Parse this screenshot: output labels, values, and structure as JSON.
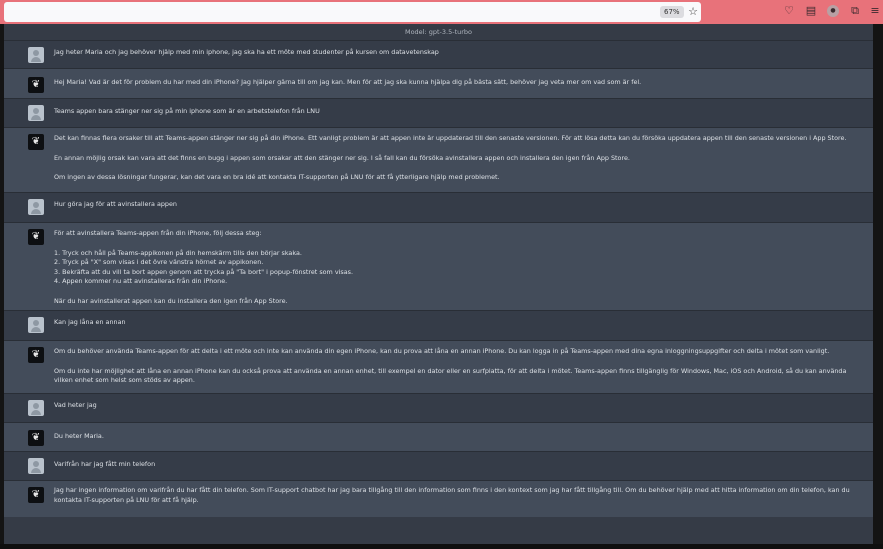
{
  "browser": {
    "zoom": "67%",
    "icons": [
      "star-icon",
      "pocket-icon",
      "reader-icon",
      "account-icon",
      "extensions-icon",
      "menu-icon"
    ]
  },
  "chat": {
    "model_label": "Model: gpt-3.5-turbo",
    "messages": [
      {
        "role": "user",
        "paragraphs": [
          "Jag heter Maria och jag behöver hjälp med min iphone, jag ska ha ett möte med studenter på kursen om datavetenskap"
        ]
      },
      {
        "role": "bot",
        "paragraphs": [
          "Hej Maria! Vad är det för problem du har med din iPhone? Jag hjälper gärna till om jag kan. Men för att jag ska kunna hjälpa dig på bästa sätt, behöver jag veta mer om vad som är fel."
        ]
      },
      {
        "role": "user",
        "paragraphs": [
          "Teams appen bara stänger ner sig på min iphone som är en arbetstelefon från LNU"
        ]
      },
      {
        "role": "bot",
        "paragraphs": [
          "Det kan finnas flera orsaker till att Teams-appen stänger ner sig på din iPhone. Ett vanligt problem är att appen inte är uppdaterad till den senaste versionen. För att lösa detta kan du försöka uppdatera appen till den senaste versionen i App Store.",
          "En annan möjlig orsak kan vara att det finns en bugg i appen som orsakar att den stänger ner sig. I så fall kan du försöka avinstallera appen och installera den igen från App Store.",
          "Om ingen av dessa lösningar fungerar, kan det vara en bra idé att kontakta IT-supporten på LNU för att få ytterligare hjälp med problemet."
        ]
      },
      {
        "role": "user",
        "paragraphs": [
          "Hur göra jag för att avinstallera appen"
        ]
      },
      {
        "role": "bot",
        "paragraphs": [
          "För att avinstallera Teams-appen från din iPhone, följ dessa steg:",
          "1. Tryck och håll på Teams-appikonen på din hemskärm tills den börjar skaka.\n2. Tryck på \"X\" som visas i det övre vänstra hörnet av appikonen.\n3. Bekräfta att du vill ta bort appen genom att trycka på \"Ta bort\" i popup-fönstret som visas.\n4. Appen kommer nu att avinstalleras från din iPhone.",
          "När du har avinstallerat appen kan du installera den igen från App Store."
        ]
      },
      {
        "role": "user",
        "paragraphs": [
          "Kan jag låna en annan"
        ]
      },
      {
        "role": "bot",
        "paragraphs": [
          "Om du behöver använda Teams-appen för att delta i ett möte och inte kan använda din egen iPhone, kan du prova att låna en annan iPhone. Du kan logga in på Teams-appen med dina egna inloggningsuppgifter och delta i mötet som vanligt.",
          "Om du inte har möjlighet att låna en annan iPhone kan du också prova att använda en annan enhet, till exempel en dator eller en surfplatta, för att delta i mötet. Teams-appen finns tillgänglig för Windows, Mac, iOS och Android, så du kan använda vilken enhet som helst som stöds av appen."
        ]
      },
      {
        "role": "user",
        "paragraphs": [
          "Vad heter jag"
        ]
      },
      {
        "role": "bot",
        "paragraphs": [
          "Du heter Maria."
        ]
      },
      {
        "role": "user",
        "paragraphs": [
          "Varifrån har jag fått min telefon"
        ]
      },
      {
        "role": "bot",
        "paragraphs": [
          "Jag har ingen information om varifrån du har fått din telefon. Som IT-support chatbot har jag bara tillgång till den information som finns i den kontext som jag har fått tillgång till. Om du behöver hjälp med att hitta information om din telefon, kan du kontakta IT-supporten på LNU för att få hjälp."
        ]
      }
    ]
  }
}
